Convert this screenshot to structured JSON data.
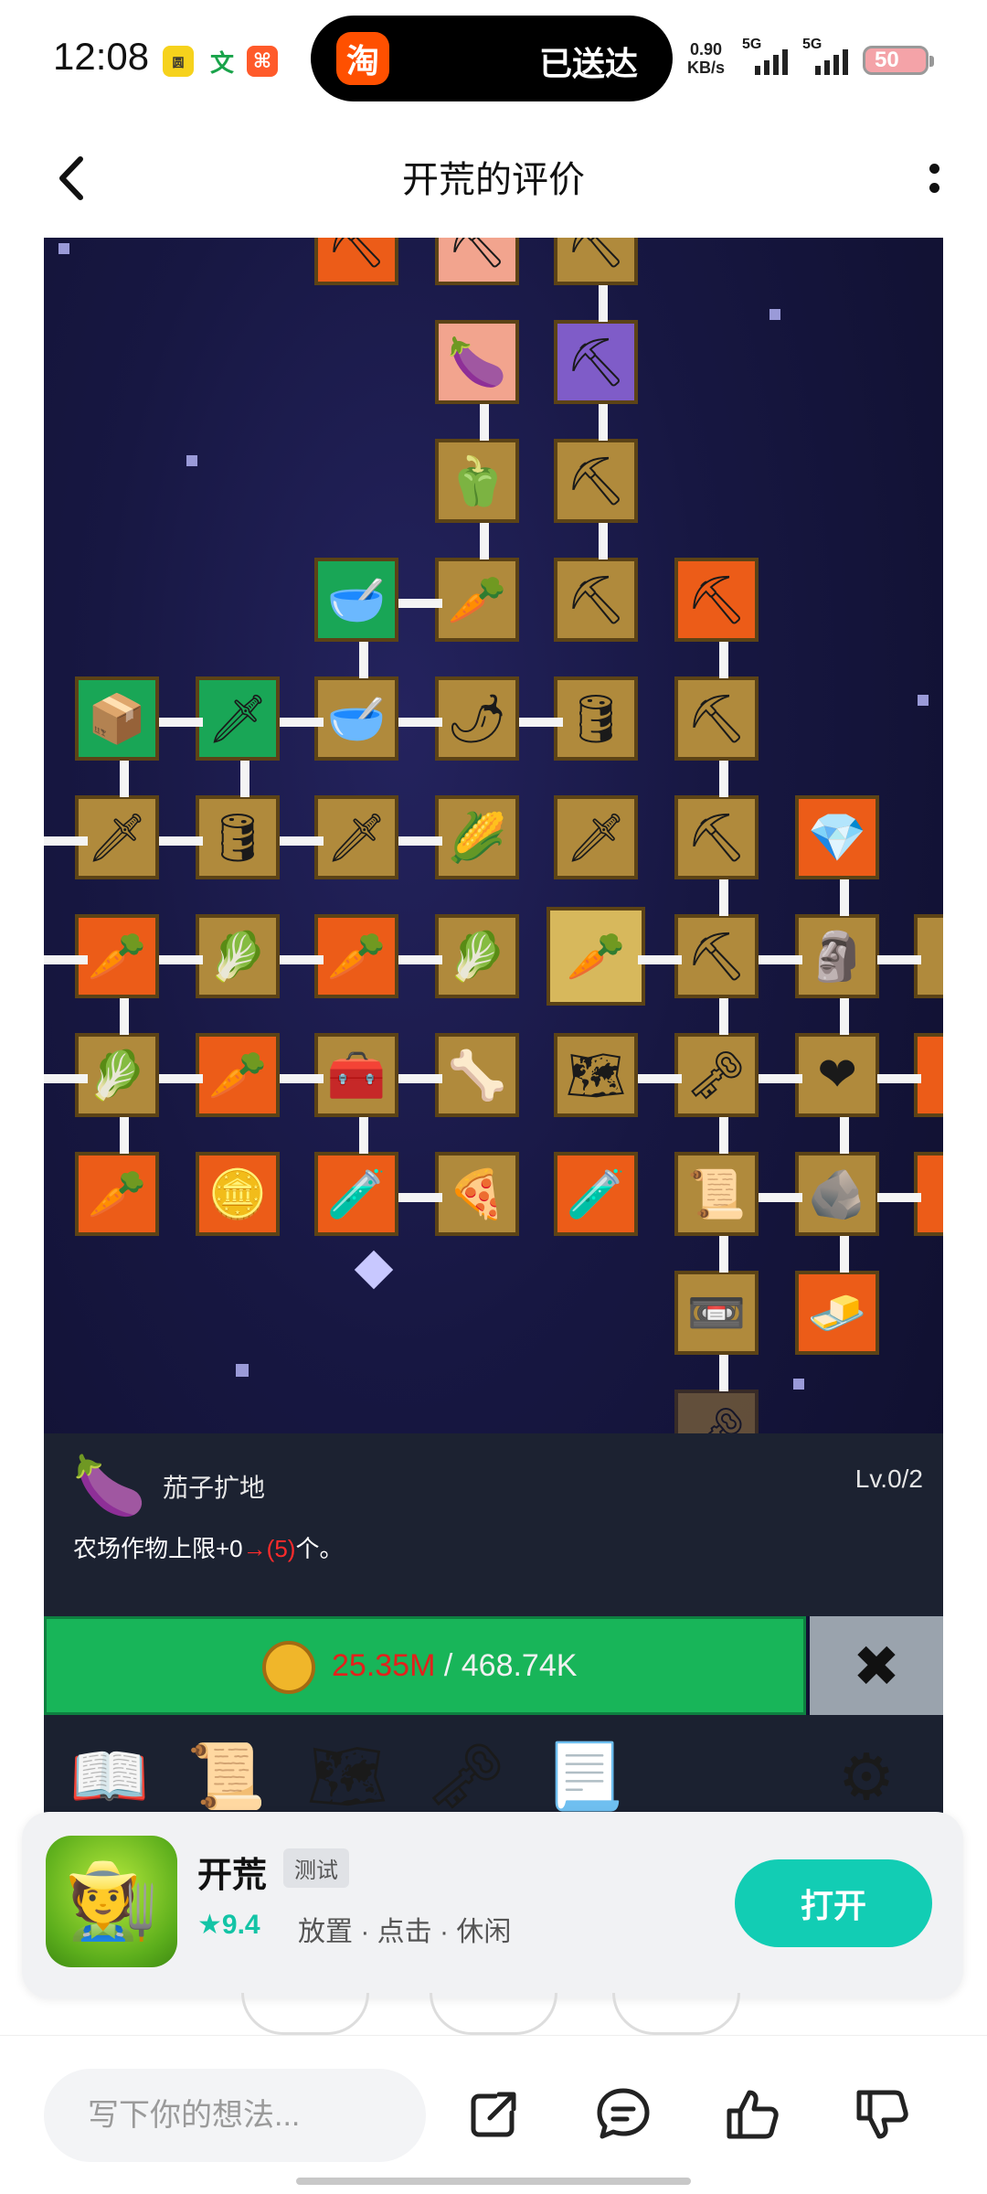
{
  "status_bar": {
    "time": "12:08",
    "pill_app_logo": "淘",
    "pill_text": "已送达",
    "net_speed_value": "0.90",
    "net_speed_unit": "KB/s",
    "signal1_label": "5G",
    "signal2_label": "5G",
    "battery": "50",
    "notif_icons": [
      "app-notification-icon",
      "translate-icon",
      "app-notification-icon"
    ],
    "notif_glyphs": [
      "圆",
      "文",
      "⌘"
    ]
  },
  "header": {
    "title": "开荒的评价"
  },
  "game": {
    "info": {
      "item_name": "茄子扩地",
      "level": "Lv.0/2",
      "desc_prefix": "农场作物上限+0",
      "desc_arrow": "→",
      "desc_next": "(5)",
      "desc_suffix": "个。"
    },
    "cost": {
      "current": "25.35M",
      "separator": " / ",
      "required": "468.74K"
    },
    "close_glyph": "✖"
  },
  "app_card": {
    "name": "开荒",
    "badge": "测试",
    "rating_star": "★",
    "rating": "9.4",
    "tags": "放置 · 点击 · 休闲",
    "open_label": "打开"
  },
  "bottom_bar": {
    "comment_placeholder": "写下你的想法..."
  },
  "colors": {
    "accent": "#12cdb4",
    "cost_green": "#18b559",
    "cost_red": "#e3211c",
    "game_bg": "#171742"
  }
}
